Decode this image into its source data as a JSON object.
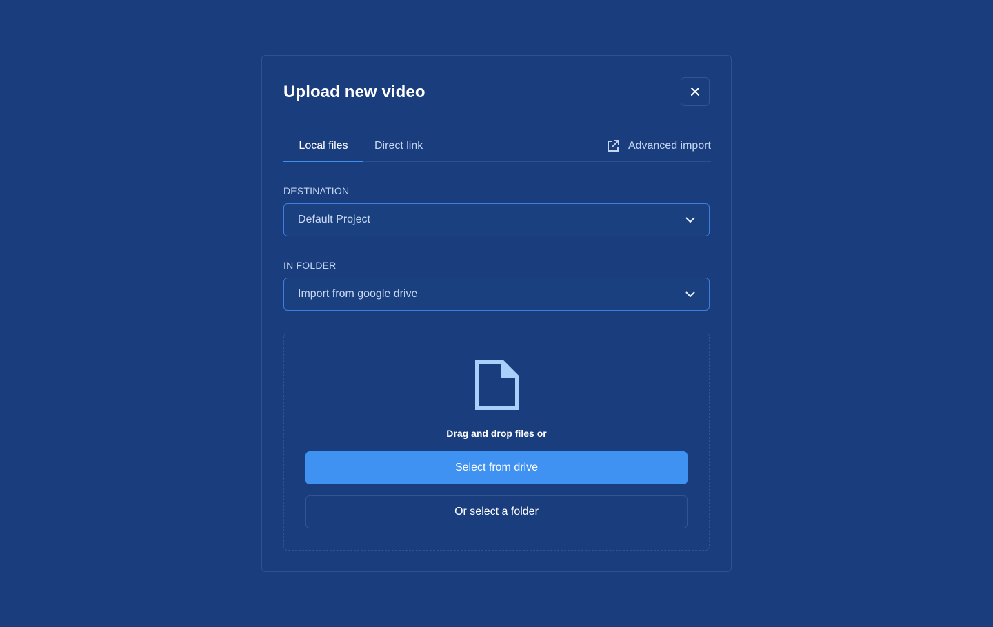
{
  "modal": {
    "title": "Upload new video",
    "close_icon": "close-icon"
  },
  "tabs": [
    {
      "label": "Local files",
      "active": true
    },
    {
      "label": "Direct link",
      "active": false
    }
  ],
  "advanced_import": {
    "label": "Advanced import",
    "icon": "external-link-icon"
  },
  "destination": {
    "label": "DESTINATION",
    "value": "Default Project",
    "icon": "chevron-down-icon"
  },
  "folder": {
    "label": "IN FOLDER",
    "value": "Import from google drive",
    "icon": "chevron-down-icon"
  },
  "dropzone": {
    "icon": "file-icon",
    "text": "Drag and drop files or",
    "primary_button": "Select from drive",
    "secondary_button": "Or select a folder"
  },
  "colors": {
    "background": "#1a3d7e",
    "accent": "#3f92f2",
    "border": "#2f5596"
  }
}
